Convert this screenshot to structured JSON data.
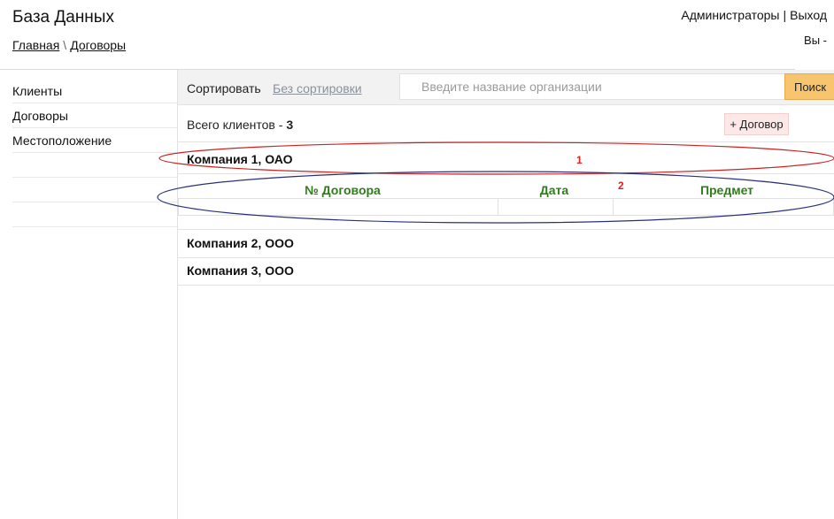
{
  "header": {
    "title": "База Данных",
    "breadcrumb": {
      "home": "Главная",
      "separator": "\\",
      "current": "Договоры"
    },
    "admin_link": "Администраторы",
    "top_separator": "|",
    "logout_link": "Выход",
    "user_line": "Вы -"
  },
  "sidebar": {
    "items": [
      {
        "label": "Клиенты"
      },
      {
        "label": "Договоры"
      },
      {
        "label": "Местоположение"
      },
      {
        "label": ""
      },
      {
        "label": ""
      },
      {
        "label": ""
      }
    ]
  },
  "toolbar": {
    "sort_label": "Сортировать",
    "sort_value": "Без сортировки",
    "search_placeholder": "Введите название организации",
    "search_button": "Поиск"
  },
  "summary": {
    "total_label": "Всего клиентов -",
    "total_count": "3",
    "add_contract_button": "+ Договор"
  },
  "companies": [
    {
      "name": "Компания 1, ОАО"
    },
    {
      "name": "Компания 2, ООО"
    },
    {
      "name": "Компания 3, ООО"
    }
  ],
  "contracts_table": {
    "columns": [
      "№ Договора",
      "Дата",
      "Предмет"
    ],
    "rows": []
  },
  "annotations": {
    "one": "1",
    "two": "2"
  },
  "colors": {
    "header_green": "#2e7d18",
    "search_button": "#f7c56d",
    "annotation_red": "#cc2222",
    "annotation_blue": "#2a2f7a"
  }
}
